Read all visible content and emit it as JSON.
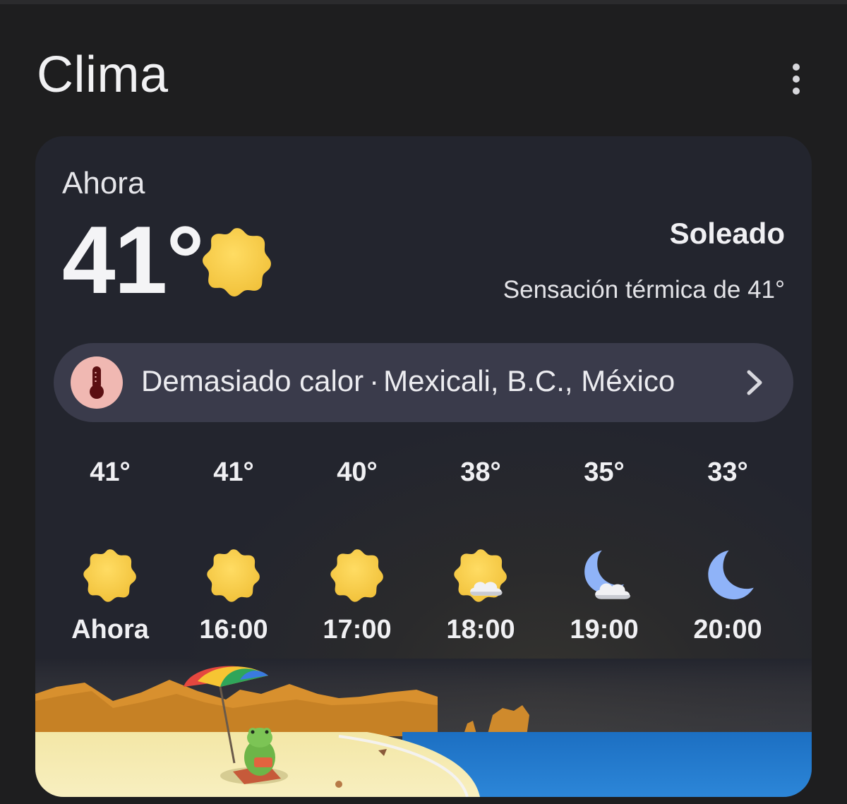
{
  "app": {
    "title": "Clima"
  },
  "current": {
    "label": "Ahora",
    "temperature": "41°",
    "condition": "Soleado",
    "feels_like": "Sensación térmica de 41°",
    "icon": "sun-icon"
  },
  "alert": {
    "title": "Demasiado calor",
    "separator": "·",
    "location": "Mexicali, B.C., México",
    "icon": "thermometer-icon",
    "icon_bg": "#f0b8b2"
  },
  "hourly": [
    {
      "temp": "41°",
      "time": "Ahora",
      "icon": "sun-icon"
    },
    {
      "temp": "41°",
      "time": "16:00",
      "icon": "sun-icon"
    },
    {
      "temp": "40°",
      "time": "17:00",
      "icon": "sun-icon"
    },
    {
      "temp": "38°",
      "time": "18:00",
      "icon": "partly-cloudy-icon"
    },
    {
      "temp": "35°",
      "time": "19:00",
      "icon": "partly-cloudy-night-icon"
    },
    {
      "temp": "33°",
      "time": "20:00",
      "icon": "moon-icon"
    }
  ],
  "colors": {
    "background": "#1e1e1f",
    "card": "#23252e",
    "pill": "#3a3b4b",
    "sun": "#f7cd46",
    "moon": "#8fb3f8"
  }
}
